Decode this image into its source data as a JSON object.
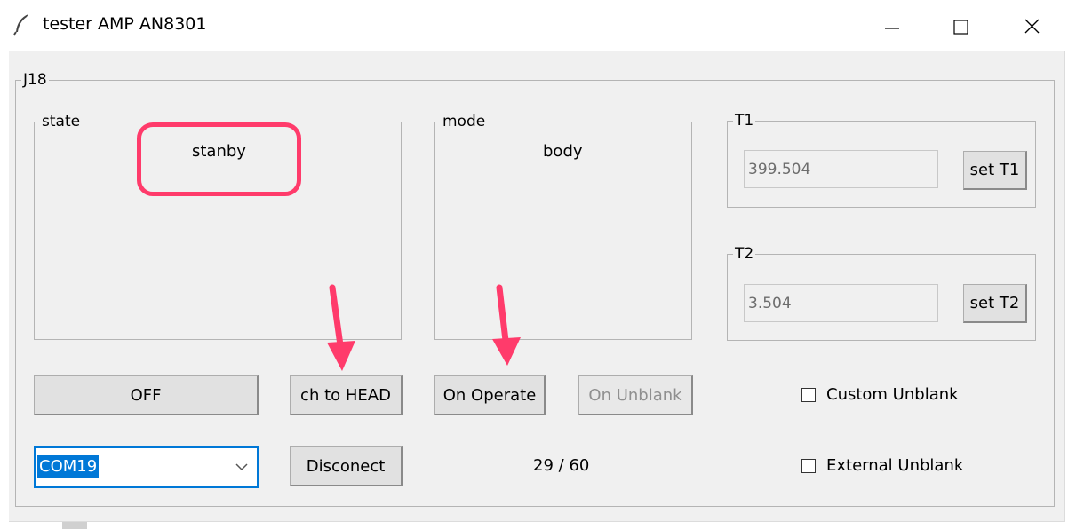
{
  "window": {
    "title": "tester AMP AN8301",
    "icon": "feather-icon",
    "controls": [
      "minimize-icon",
      "maximize-icon",
      "close-icon"
    ]
  },
  "main_group": {
    "label": "J18"
  },
  "state_group": {
    "label": "state",
    "value": "stanby"
  },
  "mode_group": {
    "label": "mode",
    "value": "body"
  },
  "t1_group": {
    "label": "T1",
    "value": "399.504",
    "button": "set T1"
  },
  "t2_group": {
    "label": "T2",
    "value": "3.504",
    "button": "set T2"
  },
  "buttons": {
    "off": "OFF",
    "ch_to_head": "ch to HEAD",
    "on_operate": "On Operate",
    "on_unblank": "On Unblank",
    "disconnect": "Disconect"
  },
  "port_select": {
    "value": "COM19"
  },
  "counter": "29 / 60",
  "checkboxes": {
    "custom_unblank": {
      "label": "Custom Unblank",
      "checked": false
    },
    "external_unblank": {
      "label": "External Unblank",
      "checked": false
    }
  },
  "colors": {
    "annotation": "#ff3b6b",
    "selection": "#0078d7",
    "window_bg": "#f0f0f0"
  }
}
